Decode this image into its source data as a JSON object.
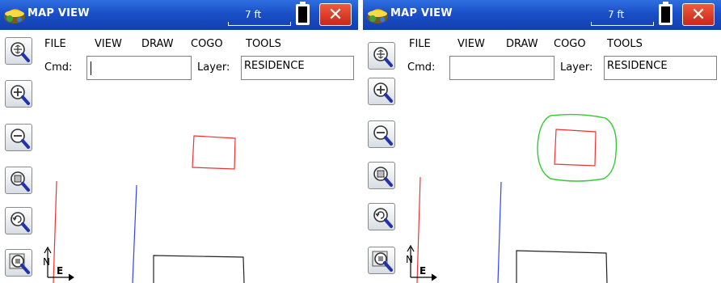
{
  "screens": [
    {
      "app_title": "MAP VIEW",
      "scale": "7 ft",
      "close_label": "✕",
      "menu": [
        "FILE",
        "VIEW",
        "DRAW",
        "COGO",
        "TOOLS"
      ],
      "cmd_label": "Cmd:",
      "cmd_value": "",
      "layer_label": "Layer:",
      "layer_value": "RESIDENCE",
      "north_label": "N",
      "east_label": "E",
      "offset_shown": false
    },
    {
      "app_title": "MAP VIEW",
      "scale": "7 ft",
      "close_label": "✕",
      "menu": [
        "FILE",
        "VIEW",
        "DRAW",
        "COGO",
        "TOOLS"
      ],
      "cmd_label": "Cmd:",
      "cmd_value": "",
      "layer_label": "Layer:",
      "layer_value": "RESIDENCE",
      "north_label": "N",
      "east_label": "E",
      "offset_shown": true
    }
  ],
  "toolbar_icons": [
    "zoom-extents-icon",
    "zoom-in-icon",
    "zoom-out-icon",
    "zoom-window-icon",
    "zoom-previous-icon",
    "zoom-object-icon"
  ],
  "colors": {
    "titlebar": "#1a4fc7",
    "close": "#d83a24",
    "residence_line": "#ee3333",
    "offset_line": "#33cc33",
    "blue_line": "#3344ee"
  }
}
